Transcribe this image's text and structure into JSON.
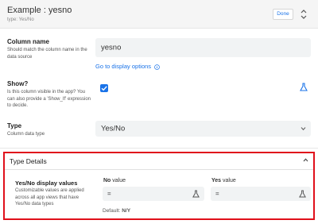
{
  "header": {
    "title": "Example : yesno",
    "subtitle": "type: Yes/No",
    "done_label": "Done"
  },
  "column_name": {
    "label": "Column name",
    "description": "Should match the column name in the data source",
    "value": "yesno",
    "link": "Go to display options"
  },
  "show": {
    "label": "Show?",
    "description": "Is this column visible in the app? You can also provide a 'Show_If' expression to decide.",
    "checked": true
  },
  "type": {
    "label": "Type",
    "description": "Column data type",
    "value": "Yes/No"
  },
  "type_details": {
    "title": "Type Details",
    "yes_no_label": "Yes/No display values",
    "yes_no_description": "Customizable values are applied across all app views that have Yes/No data types",
    "no_label_bold": "No",
    "no_label_rest": " value",
    "no_value": "=",
    "yes_label_bold": "Yes",
    "yes_label_rest": " value",
    "yes_value": "=",
    "default_prefix": "Default: ",
    "default_value": "N/Y"
  },
  "colors": {
    "accent": "#1a73e8",
    "highlight_border": "#e0101b"
  }
}
